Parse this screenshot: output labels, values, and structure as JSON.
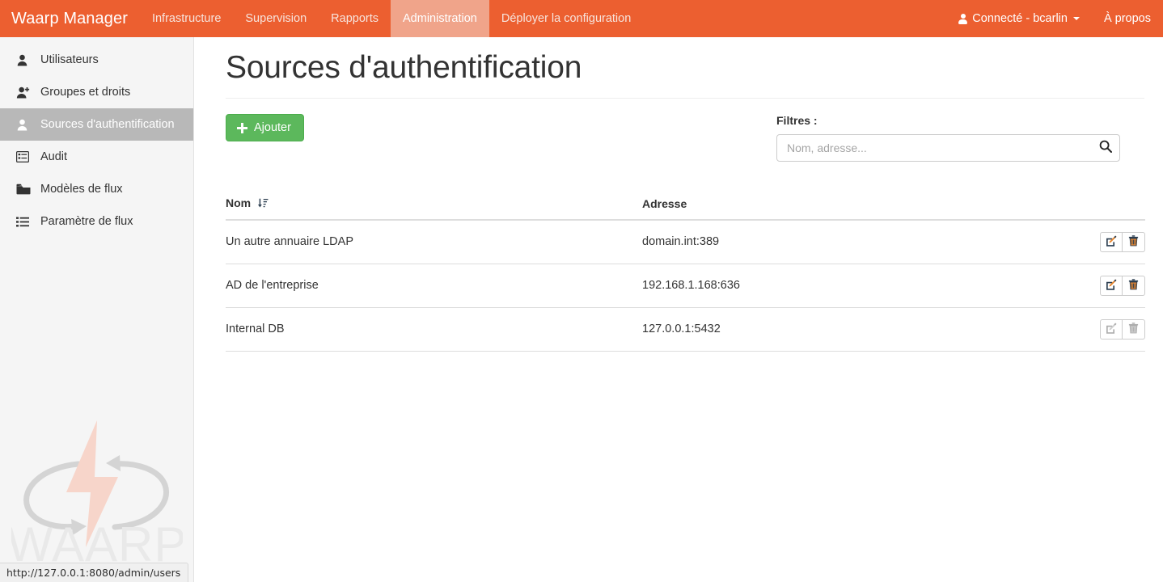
{
  "navbar": {
    "brand": "Waarp Manager",
    "links": [
      {
        "label": "Infrastructure",
        "active": false
      },
      {
        "label": "Supervision",
        "active": false
      },
      {
        "label": "Rapports",
        "active": false
      },
      {
        "label": "Administration",
        "active": true
      },
      {
        "label": "Déployer la configuration",
        "active": false
      }
    ],
    "user_label": "Connecté - bcarlin",
    "about_label": "À propos",
    "bg_color": "#ec5f30",
    "active_bg_color": "#f0a48a"
  },
  "sidebar": {
    "items": [
      {
        "label": "Utilisateurs",
        "icon": "user-icon",
        "active": false
      },
      {
        "label": "Groupes et droits",
        "icon": "user-plus-icon",
        "active": false
      },
      {
        "label": "Sources d'authentification",
        "icon": "user-icon",
        "active": true
      },
      {
        "label": "Audit",
        "icon": "list-alt-icon",
        "active": false
      },
      {
        "label": "Modèles de flux",
        "icon": "folder-icon",
        "active": false
      },
      {
        "label": "Paramètre de flux",
        "icon": "list-icon",
        "active": false
      }
    ],
    "watermark_text": "WAARP",
    "watermark_bolt_color": "#f7d5ca",
    "watermark_arrow_color": "#d2d2d2",
    "active_bg_color": "#b8b8b8"
  },
  "main": {
    "page_title": "Sources d'authentification",
    "add_button": "Ajouter",
    "add_button_color": "#5cb85c",
    "filters_label": "Filtres :",
    "search_placeholder": "Nom, adresse...",
    "search_value": "",
    "table": {
      "columns": [
        "Nom",
        "Adresse"
      ],
      "sort_column": "Nom",
      "sort_icon": "sort-amount-down-icon",
      "rows": [
        {
          "nom": "Un autre annuaire LDAP",
          "adresse": "domain.int:389",
          "editable": true,
          "deletable": true
        },
        {
          "nom": "AD de l'entreprise",
          "adresse": "192.168.1.168:636",
          "editable": true,
          "deletable": true
        },
        {
          "nom": "Internal DB",
          "adresse": "127.0.0.1:5432",
          "editable": false,
          "deletable": false
        }
      ],
      "edit_icon": "edit-icon",
      "delete_icon": "trash-icon"
    }
  },
  "statusbar": {
    "url": "http://127.0.0.1:8080/admin/users"
  }
}
